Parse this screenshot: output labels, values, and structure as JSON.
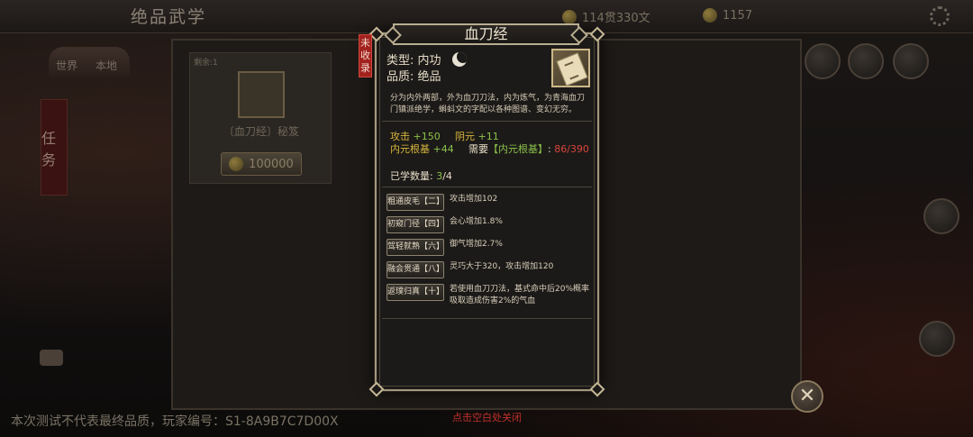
{
  "header": {
    "title": "绝品武学",
    "currency_1": "114贯330文",
    "currency_2": "1157"
  },
  "left_panel": {
    "tab_world": "世界",
    "tab_local": "本地",
    "task_tab": "任务"
  },
  "item_card": {
    "remain_label": "剩余:1",
    "name": "〔血刀经〕秘笈",
    "price": "100000"
  },
  "modal": {
    "title": "血刀经",
    "uncollected_tag": [
      "未",
      "收",
      "录"
    ],
    "type_label": "类型:",
    "type_value": "内功",
    "quality_label": "品质:",
    "quality_value": "绝品",
    "description": "分为内外两部，外为血刀刀法，内为炼气，为青海血刀门镇派绝学，蝌蚪文的字配以各种图谱、变幻无穷。",
    "stats": {
      "attack_key": "攻击",
      "attack_val": "+150",
      "yin_key": "阴元",
      "yin_val": "+11",
      "root_key": "内元根基",
      "root_val": "+44",
      "need_prefix": "需要",
      "need_bracket": "【内元根基】",
      "need_colon": ":",
      "need_value": "86/390"
    },
    "learned_label": "已学数量:",
    "learned_current": "3",
    "learned_total": "/4",
    "skills": [
      {
        "level": "粗通皮毛【二】",
        "effect": "攻击增加102"
      },
      {
        "level": "初窥门径【四】",
        "effect": "会心增加1.8%"
      },
      {
        "level": "驾轻就熟【六】",
        "effect": "御气增加2.7%"
      },
      {
        "level": "融会贯通【八】",
        "effect": "灵巧大于320，攻击增加120"
      },
      {
        "level": "返璞归真【十】",
        "effect": "若使用血刀刀法，基式命中后20%概率吸取造成伤害2%的气血"
      }
    ]
  },
  "footer": {
    "test_notice": "本次测试不代表最终品质，玩家编号：S1-8A9B7C7D00X",
    "close_hint": "点击空白处关闭",
    "close_symbol": "✕"
  },
  "colors": {
    "accent_gold": "#d7b63c",
    "positive_green": "#8bc14a",
    "warning_red": "#d8453b",
    "tag_red": "#a3221e"
  }
}
